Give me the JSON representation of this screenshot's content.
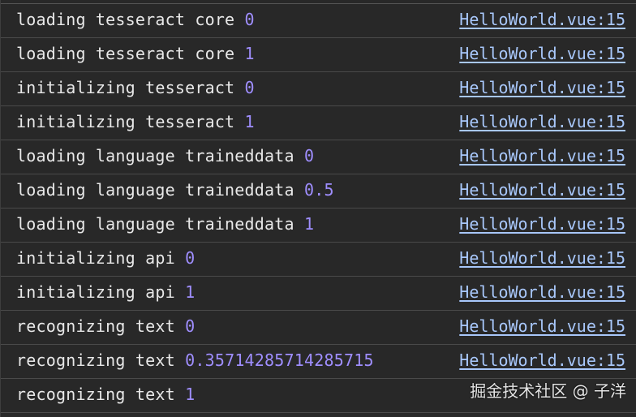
{
  "console": {
    "rows": [
      {
        "text": "loading tesseract core ",
        "value": "0",
        "source": "HelloWorld.vue:15"
      },
      {
        "text": "loading tesseract core ",
        "value": "1",
        "source": "HelloWorld.vue:15"
      },
      {
        "text": "initializing tesseract ",
        "value": "0",
        "source": "HelloWorld.vue:15"
      },
      {
        "text": "initializing tesseract ",
        "value": "1",
        "source": "HelloWorld.vue:15"
      },
      {
        "text": "loading language traineddata ",
        "value": "0",
        "source": "HelloWorld.vue:15"
      },
      {
        "text": "loading language traineddata ",
        "value": "0.5",
        "source": "HelloWorld.vue:15"
      },
      {
        "text": "loading language traineddata ",
        "value": "1",
        "source": "HelloWorld.vue:15"
      },
      {
        "text": "initializing api ",
        "value": "0",
        "source": "HelloWorld.vue:15"
      },
      {
        "text": "initializing api ",
        "value": "1",
        "source": "HelloWorld.vue:15"
      },
      {
        "text": "recognizing text ",
        "value": "0",
        "source": "HelloWorld.vue:15"
      },
      {
        "text": "recognizing text ",
        "value": "0.35714285714285715",
        "source": "HelloWorld.vue:15"
      },
      {
        "text": "recognizing text ",
        "value": "1",
        "source": ""
      }
    ]
  },
  "watermark": "掘金技术社区 @ 子洋",
  "colors": {
    "background": "#282828",
    "text": "#e8e8e8",
    "number": "#9f8eff",
    "link": "#a8c7fa",
    "divider": "#4a4a4a"
  }
}
